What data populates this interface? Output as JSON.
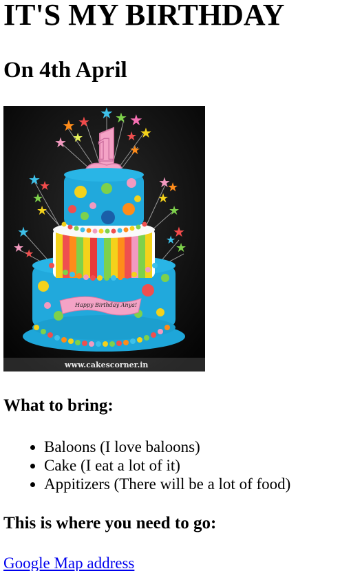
{
  "heading": "IT'S MY BIRTHDAY",
  "subheading": "On 4th April",
  "image": {
    "icon": "birthday-cake-photo",
    "cake_banner_text": "Happy Birthday Anya!",
    "watermark": "www.cakescorner.in",
    "cake_number": "1"
  },
  "bring": {
    "title": "What to bring:",
    "items": [
      "Baloons (I love baloons)",
      "Cake (I eat a lot of it)",
      "Appitizers (There will be a lot of food)"
    ]
  },
  "location": {
    "title": "This is where you need to go:",
    "link_text": "Google Map address"
  },
  "colors": {
    "link": "#0000ee",
    "cake_blue": "#1ea6d9",
    "background": "#ffffff"
  }
}
